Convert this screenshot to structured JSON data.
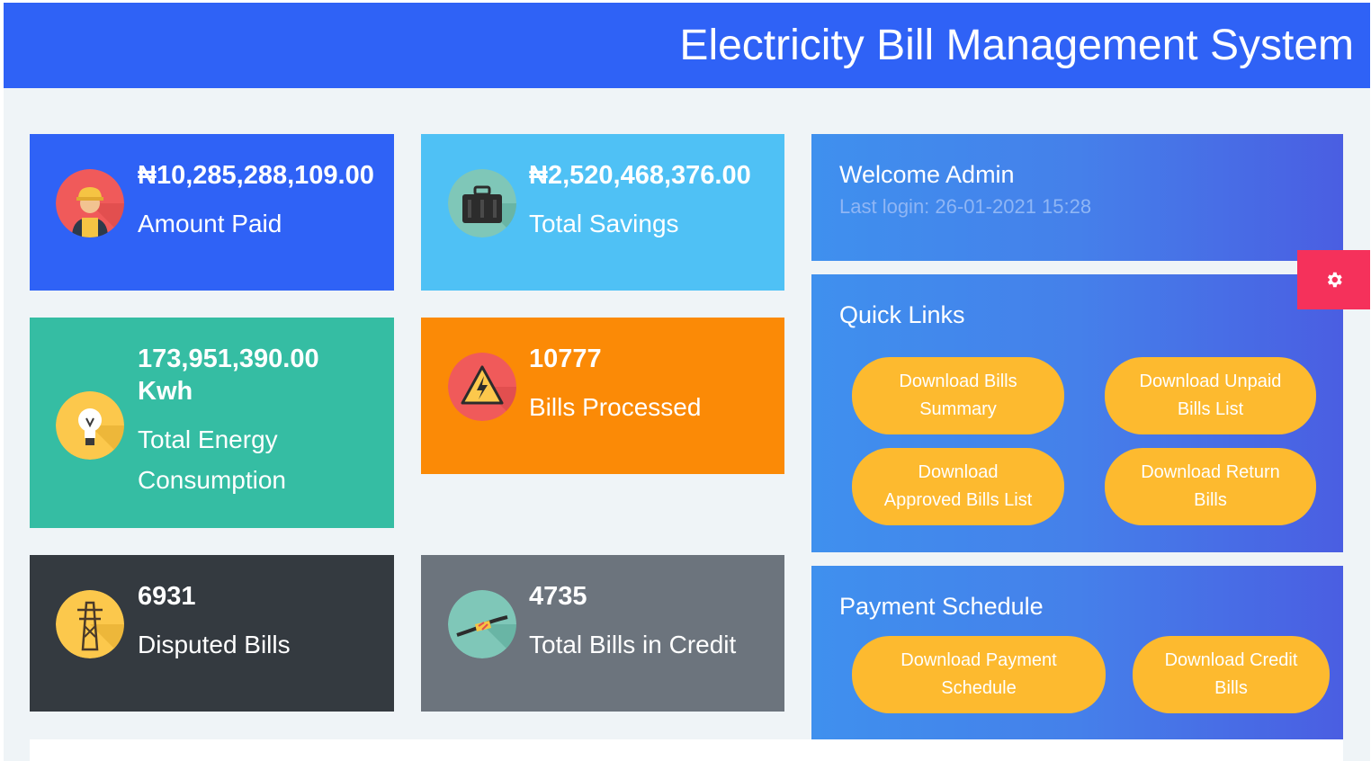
{
  "header": {
    "title": "Electricity Bill Management System",
    "color": "#2f62f6"
  },
  "cards": {
    "paid": {
      "value": "₦10,285,288,109.00",
      "label": "Amount Paid",
      "icon": "worker-icon",
      "color": "#2f62f6"
    },
    "savings": {
      "value": "₦2,520,468,376.00",
      "label": "Total Savings",
      "icon": "toolbox-icon",
      "color": "#4fc1f5"
    },
    "energy": {
      "value_line1": "173,951,390.00",
      "value_line2": "Kwh",
      "label_line1": "Total Energy",
      "label_line2": "Consumption",
      "icon": "lightbulb-icon",
      "color": "#35bda3"
    },
    "bills": {
      "value": "10777",
      "label": "Bills Processed",
      "icon": "high-voltage-warning-icon",
      "color": "#fb8a06"
    },
    "disputed": {
      "value": "6931",
      "label": "Disputed Bills",
      "icon": "power-pylon-icon",
      "color": "#343a40"
    },
    "credit": {
      "value": "4735",
      "label": "Total Bills in Credit",
      "icon": "power-cable-icon",
      "color": "#6c747d"
    }
  },
  "welcome": {
    "title": "Welcome Admin",
    "last_login": "Last login: 26-01-2021 15:28"
  },
  "quick_links": {
    "title": "Quick Links",
    "buttons": [
      {
        "line1": "Download Bills",
        "line2": "Summary"
      },
      {
        "line1": "Download Unpaid",
        "line2": "Bills List"
      },
      {
        "line1": "Download",
        "line2": "Approved Bills List"
      },
      {
        "line1": "Download Return",
        "line2": "Bills"
      }
    ]
  },
  "payment_schedule": {
    "title": "Payment Schedule",
    "buttons": [
      {
        "line1": "Download Payment",
        "line2": "Schedule"
      },
      {
        "line1": "Download Credit",
        "line2": "Bills"
      }
    ]
  },
  "settings": {
    "icon": "gear-icon",
    "color": "#f5315b"
  },
  "colors": {
    "button": "#fdba2f",
    "content_bg": "#eff4f7"
  }
}
